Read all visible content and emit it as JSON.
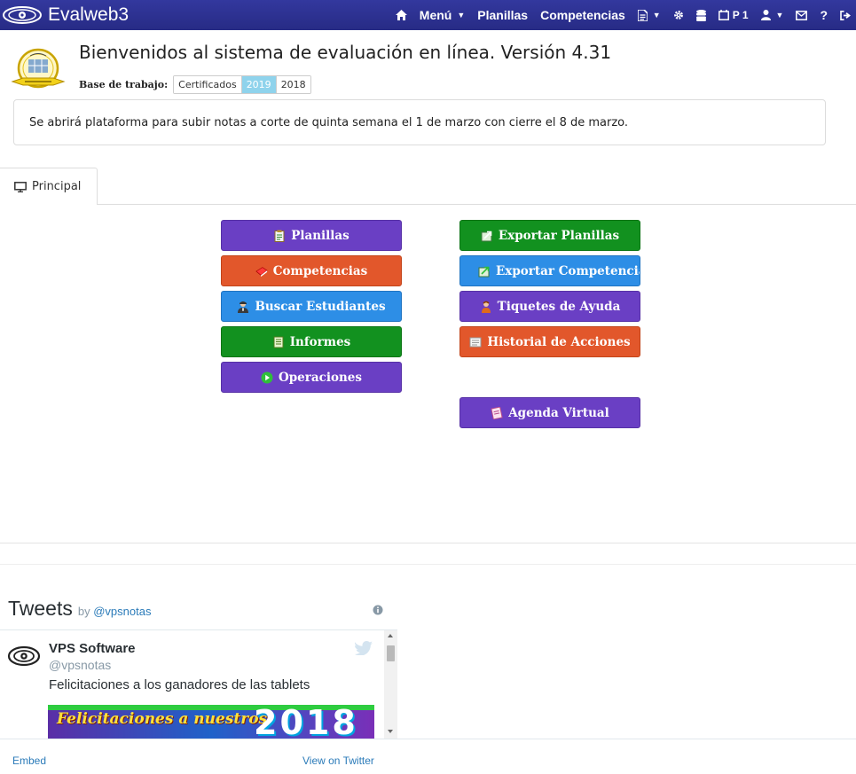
{
  "brand": {
    "name": "Evalweb3"
  },
  "nav": {
    "menu": "Menú",
    "planillas": "Planillas",
    "competencias": "Competencias",
    "period": "P 1"
  },
  "header": {
    "welcome": "Bienvenidos al sistema de evaluación en línea. Versión 4.31",
    "base_label": "Base de trabajo:",
    "base_options": [
      "Certificados",
      "2019",
      "2018"
    ],
    "base_selected": "2019"
  },
  "notice": "Se abrirá plataforma para subir notas a corte de quinta semana el 1 de marzo con cierre el 8 de marzo.",
  "tabs": [
    {
      "label": "Principal"
    }
  ],
  "buttons": {
    "planillas": "Planillas",
    "competencias": "Competencias",
    "buscar_estudiantes": "Buscar Estudiantes",
    "informes": "Informes",
    "operaciones": "Operaciones",
    "exportar_planillas": "Exportar Planillas",
    "exportar_competencias": "Exportar Competencias",
    "tiquetes_ayuda": "Tiquetes de Ayuda",
    "historial_acciones": "Historial de Acciones",
    "agenda_virtual": "Agenda Virtual"
  },
  "colors": {
    "navbar": "#2e3192",
    "purple": "#6a3fc4",
    "orange": "#e2572b",
    "blue": "#2d8ee6",
    "green": "#12911f",
    "selected_year": "#8fd3ec"
  },
  "tweets": {
    "title": "Tweets",
    "by": "by",
    "handle_link": "@vpsnotas",
    "author_name": "VPS Software",
    "author_handle": "@vpsnotas",
    "text": "Felicitaciones a los ganadores de las tablets",
    "media_text": "Felicitaciones a nuestros",
    "media_year": "2018",
    "embed": "Embed",
    "view_on_twitter": "View on Twitter"
  }
}
